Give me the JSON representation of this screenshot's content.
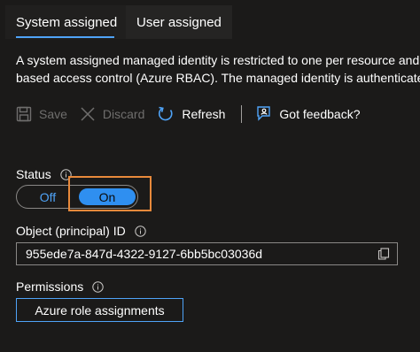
{
  "tabs": [
    {
      "label": "System assigned",
      "active": true
    },
    {
      "label": "User assigned",
      "active": false
    }
  ],
  "description": {
    "line1": "A system assigned managed identity is restricted to one per resource and is",
    "line2": "based access control (Azure RBAC). The managed identity is authenticated w"
  },
  "toolbar": {
    "save_label": "Save",
    "discard_label": "Discard",
    "refresh_label": "Refresh",
    "feedback_label": "Got feedback?"
  },
  "status": {
    "label": "Status",
    "off_label": "Off",
    "on_label": "On",
    "value": "On"
  },
  "object_id": {
    "label": "Object (principal) ID",
    "value": "955ede7a-847d-4322-9127-6bb5bc03036d"
  },
  "permissions": {
    "label": "Permissions",
    "button_label": "Azure role assignments"
  },
  "colors": {
    "background": "#1b1a19",
    "accent": "#4fa3f7",
    "toggle_on": "#2f8ff0",
    "highlight": "#e8893b",
    "disabled": "#6f6e6d"
  }
}
